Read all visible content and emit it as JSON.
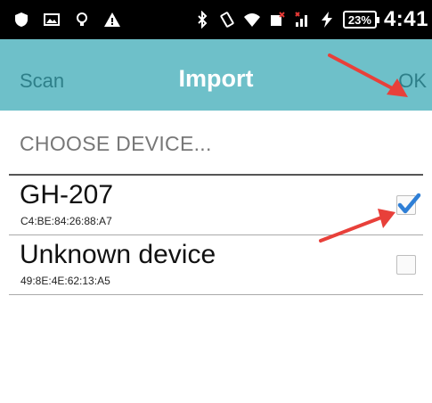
{
  "status_bar": {
    "battery_percent": "23%",
    "time": "4:41",
    "left_icons": [
      "shield-icon",
      "image-icon",
      "lightbulb-icon",
      "warning-icon"
    ],
    "right_icons": [
      "bluetooth-icon",
      "vibrate-icon",
      "wifi-icon",
      "data-icon",
      "signal-icon",
      "charging-icon"
    ]
  },
  "action_bar": {
    "scan_label": "Scan",
    "title": "Import",
    "ok_label": "OK",
    "background_color": "#6ec0c9"
  },
  "section_header": "CHOOSE DEVICE...",
  "devices": [
    {
      "name": "GH-207",
      "mac": "C4:BE:84:26:88:A7",
      "checked": true
    },
    {
      "name": "Unknown device",
      "mac": "49:8E:4E:62:13:A5",
      "checked": false
    }
  ],
  "annotation_color": "#e8403a"
}
